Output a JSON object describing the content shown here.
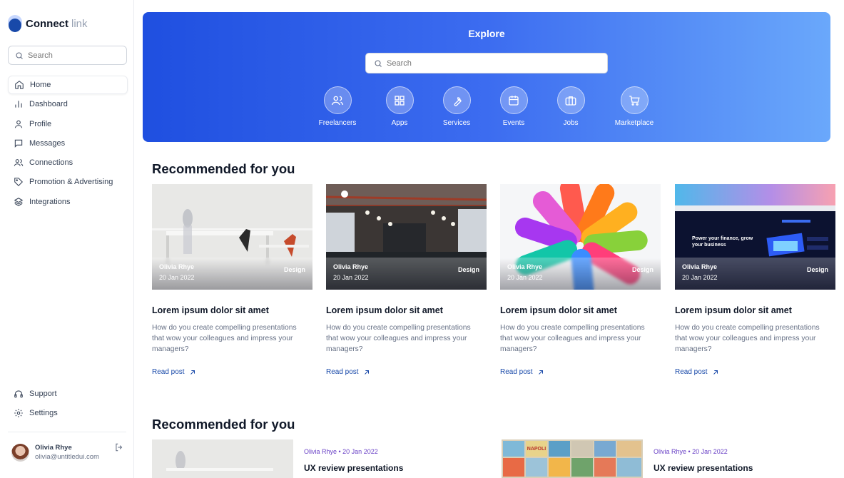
{
  "brand": {
    "name": "Connect",
    "suffix": "link"
  },
  "sidebar": {
    "search_placeholder": "Search",
    "items": [
      {
        "label": "Home",
        "icon": "home-icon"
      },
      {
        "label": "Dashboard",
        "icon": "bar-chart-icon"
      },
      {
        "label": "Profile",
        "icon": "user-icon"
      },
      {
        "label": "Messages",
        "icon": "message-icon"
      },
      {
        "label": "Connections",
        "icon": "users-icon"
      },
      {
        "label": "Promotion & Advertising",
        "icon": "tag-icon"
      },
      {
        "label": "Integrations",
        "icon": "layers-icon"
      }
    ],
    "bottom_items": [
      {
        "label": "Support",
        "icon": "headphones-icon"
      },
      {
        "label": "Settings",
        "icon": "gear-icon"
      }
    ],
    "user": {
      "name": "Olivia Rhye",
      "email": "olivia@untitledui.com"
    }
  },
  "hero": {
    "title": "Explore",
    "search_placeholder": "Search",
    "categories": [
      {
        "label": "Freelancers",
        "icon": "users-icon"
      },
      {
        "label": "Apps",
        "icon": "grid-icon"
      },
      {
        "label": "Services",
        "icon": "wrench-icon"
      },
      {
        "label": "Events",
        "icon": "calendar-icon"
      },
      {
        "label": "Jobs",
        "icon": "briefcase-icon"
      },
      {
        "label": "Marketplace",
        "icon": "cart-icon"
      }
    ]
  },
  "section1": {
    "title": "Recommended for you",
    "cards": [
      {
        "author": "Olivia Rhye",
        "date": "20 Jan 2022",
        "tag": "Design",
        "title": "Lorem ipsum dolor sit amet",
        "desc": "How do you create compelling presentations that wow your colleagues and impress your managers?",
        "link": "Read post"
      },
      {
        "author": "Olivia Rhye",
        "date": "20 Jan 2022",
        "tag": "Design",
        "title": "Lorem ipsum dolor sit amet",
        "desc": "How do you create compelling presentations that wow your colleagues and impress your managers?",
        "link": "Read post"
      },
      {
        "author": "Olivia Rhye",
        "date": "20 Jan 2022",
        "tag": "Design",
        "title": "Lorem ipsum dolor sit amet",
        "desc": "How do you create compelling presentations that wow your colleagues and impress your managers?",
        "link": "Read post"
      },
      {
        "author": "Olivia Rhye",
        "date": "20 Jan 2022",
        "tag": "Design",
        "title": "Lorem ipsum dolor sit amet",
        "desc": "How do you create compelling presentations that wow your colleagues and impress your managers?",
        "link": "Read post"
      }
    ]
  },
  "section2": {
    "title": "Recommended for you",
    "rows": [
      {
        "meta": "Olivia Rhye • 20 Jan 2022",
        "title": "UX review presentations"
      },
      {
        "meta": "Olivia Rhye • 20 Jan 2022",
        "title": "UX review presentations"
      }
    ]
  },
  "screen_text": {
    "card4_headline": "Power your finance, grow your business",
    "postcard_text": "NAPOLI"
  },
  "colors": {
    "accent": "#1849a9",
    "hero_start": "#1f4fe0",
    "hero_end": "#6aa8fb",
    "meta": "#6941c6"
  }
}
